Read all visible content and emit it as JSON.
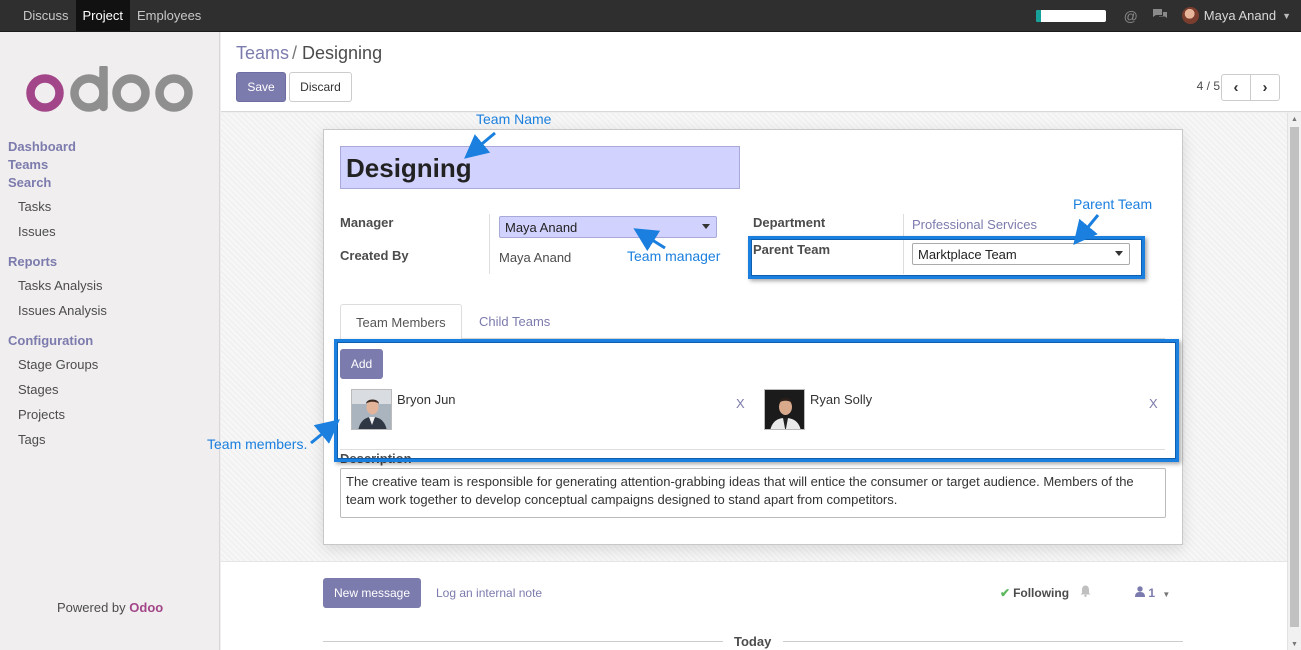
{
  "topbar": {
    "apps": [
      "Discuss",
      "Project",
      "Employees"
    ],
    "active_app": "Project",
    "user_name": "Maya Anand",
    "progress_fraction": 0.07
  },
  "sidebar": {
    "logo_text": "odoo",
    "top_items": [
      "Dashboard",
      "Teams",
      "Search"
    ],
    "search_items": [
      "Tasks",
      "Issues"
    ],
    "reports_label": "Reports",
    "reports_items": [
      "Tasks Analysis",
      "Issues Analysis"
    ],
    "config_label": "Configuration",
    "config_items": [
      "Stage Groups",
      "Stages",
      "Projects",
      "Tags"
    ],
    "powered_prefix": "Powered by",
    "powered_brand": "Odoo"
  },
  "control_panel": {
    "breadcrumb_parent": "Teams",
    "breadcrumb_sep": "/",
    "breadcrumb_current": "Designing",
    "save_label": "Save",
    "discard_label": "Discard",
    "pager_text": "4 / 5",
    "prev_icon": "chevron-left-icon",
    "next_icon": "chevron-right-icon"
  },
  "form": {
    "team_name": "Designing",
    "manager_label": "Manager",
    "manager_value": "Maya Anand",
    "created_by_label": "Created By",
    "created_by_value": "Maya Anand",
    "department_label": "Department",
    "department_value": "Professional Services",
    "parent_team_label": "Parent Team",
    "parent_team_value": "Marktplace Team",
    "tabs": [
      "Team Members",
      "Child Teams"
    ],
    "add_label": "Add",
    "members": [
      {
        "name": "Bryon Jun",
        "remove": "X"
      },
      {
        "name": "Ryan Solly",
        "remove": "X"
      }
    ],
    "description_label": "Description",
    "description_text": "The creative team is responsible for generating attention-grabbing ideas that will entice the consumer or target audience. Members of the team work together to develop conceptual campaigns designed to stand apart from competitors."
  },
  "annotations": {
    "team_name": "Team Name",
    "team_manager": "Team manager",
    "parent_team": "Parent Team",
    "team_members": "Team members."
  },
  "chatter": {
    "new_message_label": "New message",
    "log_note_label": "Log an internal note",
    "following_label": "Following",
    "followers_count": "1",
    "today_label": "Today"
  },
  "colors": {
    "brand": "#7c7bad",
    "annotation": "#1a7fde",
    "title_bg": "#d2d2ff",
    "odoo_purple": "#a24689"
  }
}
